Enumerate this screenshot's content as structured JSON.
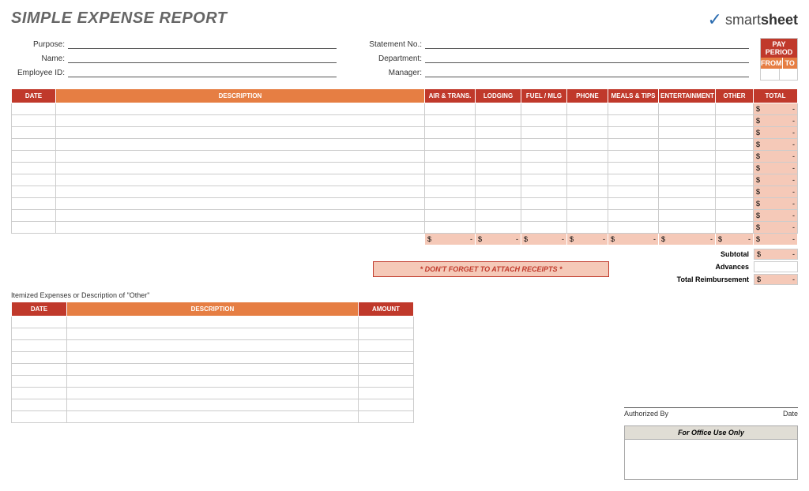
{
  "title": "SIMPLE EXPENSE REPORT",
  "logo": {
    "smart": "smart",
    "sheet": "sheet"
  },
  "fields": {
    "left": [
      {
        "label": "Purpose:"
      },
      {
        "label": "Name:"
      },
      {
        "label": "Employee ID:"
      }
    ],
    "right": [
      {
        "label": "Statement No.:"
      },
      {
        "label": "Department:"
      },
      {
        "label": "Manager:"
      }
    ]
  },
  "payperiod": {
    "title": "PAY PERIOD",
    "from": "FROM",
    "to": "TO"
  },
  "main_headers": [
    "DATE",
    "DESCRIPTION",
    "AIR & TRANS.",
    "LODGING",
    "FUEL / MLG",
    "PHONE",
    "MEALS & TIPS",
    "ENTERTAINMENT",
    "OTHER",
    "TOTAL"
  ],
  "main_rows": 11,
  "total_placeholder": {
    "dollar": "$",
    "dash": "-"
  },
  "receipt_note": "* DON'T FORGET TO ATTACH RECEIPTS *",
  "summary": {
    "subtotal": "Subtotal",
    "advances": "Advances",
    "total_reimb": "Total Reimbursement"
  },
  "itemized_label": "Itemized Expenses or Description of \"Other\"",
  "item_headers": [
    "DATE",
    "DESCRIPTION",
    "AMOUNT"
  ],
  "item_rows": 9,
  "sig": {
    "auth": "Authorized By",
    "date": "Date"
  },
  "office": "For Office Use Only"
}
